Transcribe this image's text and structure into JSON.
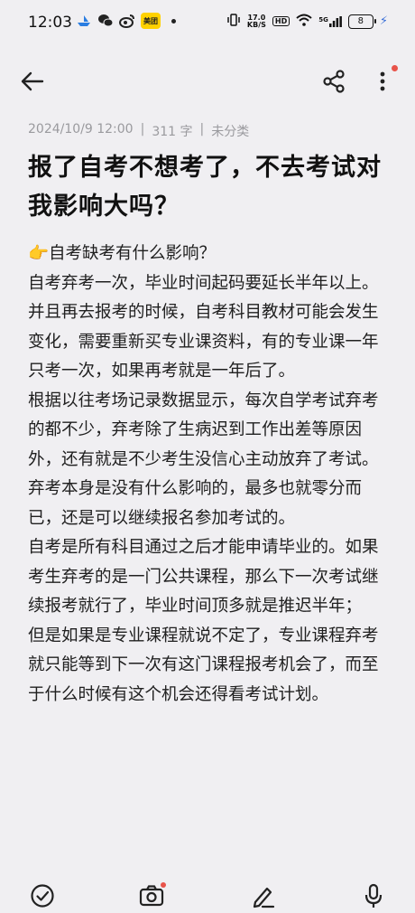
{
  "status": {
    "time": "12:03",
    "net_speed_top": "17.0",
    "net_speed_unit": "KB/S",
    "hd_label": "HD",
    "signal_label": "5G",
    "battery": "8",
    "app_meituan": "美团"
  },
  "note": {
    "date": "2024/10/9 12:00",
    "word_count": "311 字",
    "category": "未分类",
    "title": "报了自考不想考了，不去考试对我影响大吗？",
    "paragraphs": [
      "👉自考缺考有什么影响？",
      "自考弃考一次，毕业时间起码要延长半年以上。并且再去报考的时候，自考科目教材可能会发生变化，需要重新买专业课资料，有的专业课一年只考一次，如果再考就是一年后了。",
      "根据以往考场记录数据显示，每次自学考试弃考的都不少，弃考除了生病迟到工作出差等原因外，还有就是不少考生没信心主动放弃了考试。",
      "弃考本身是没有什么影响的，最多也就零分而已，还是可以继续报名参加考试的。",
      "自考是所有科目通过之后才能申请毕业的。如果考生弃考的是一门公共课程，那么下一次考试继续报考就行了，毕业时间顶多就是推迟半年；",
      "但是如果是专业课程就说不定了，专业课程弃考就只能等到下一次有这门课程报考机会了，而至于什么时候有这个机会还得看考试计划。"
    ]
  },
  "colors": {
    "accent_dot": "#e8534a",
    "meta_text": "#9a9a9e",
    "background": "#f0eff2"
  }
}
